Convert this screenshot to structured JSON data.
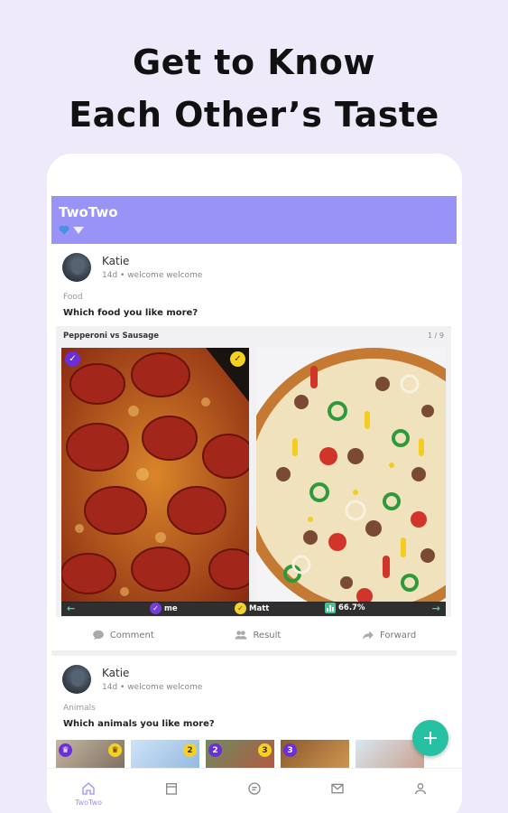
{
  "headline": {
    "line1": "Get to Know",
    "line2": "Each Other’s Taste"
  },
  "app": {
    "title": "TwoTwo"
  },
  "posts": [
    {
      "author": "Katie",
      "meta": "14d • welcome welcome",
      "category": "Food",
      "question": "Which food you like more?",
      "compare_title": "Pepperoni vs Sausage",
      "page": "1 / 9",
      "voters": [
        {
          "name": "me"
        },
        {
          "name": "Matt"
        }
      ],
      "percent": "66.7%",
      "actions": {
        "comment": "Comment",
        "result": "Result",
        "forward": "Forward"
      }
    },
    {
      "author": "Katie",
      "meta": "14d • welcome welcome",
      "category": "Animals",
      "question": "Which animals you like more?",
      "thumb_numbers": [
        "",
        "2",
        "2",
        "3",
        "3",
        ""
      ]
    }
  ],
  "fab": {
    "label": "+"
  },
  "nav": {
    "home_label": "TwoTwo"
  },
  "colors": {
    "accent": "#9a93f7",
    "fab": "#26c0a3",
    "badge_purple": "#6b2fd9",
    "badge_yellow": "#f4d21f",
    "background": "#eeeaf9"
  }
}
